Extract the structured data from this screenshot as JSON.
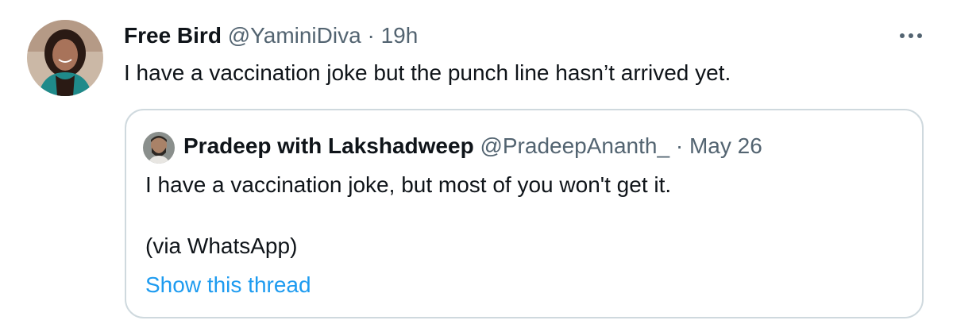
{
  "tweet": {
    "author_name": "Free Bird",
    "author_handle": "@YaminiDiva",
    "separator": "·",
    "time": "19h",
    "text": "I have a vaccination joke but the punch line hasn’t arrived yet.",
    "more_icon": "more-horizontal-icon"
  },
  "quoted_tweet": {
    "author_name": "Pradeep with Lakshadweep",
    "author_handle": "@PradeepAnanth_",
    "separator": "·",
    "date": "May 26",
    "text_line1": "I have a vaccination joke, but most of you won't get it.",
    "text_line2": "(via WhatsApp)",
    "show_thread_label": "Show this thread"
  },
  "colors": {
    "text": "#0f1419",
    "muted": "#536471",
    "link": "#1d9bf0",
    "border": "#cfd9de"
  }
}
